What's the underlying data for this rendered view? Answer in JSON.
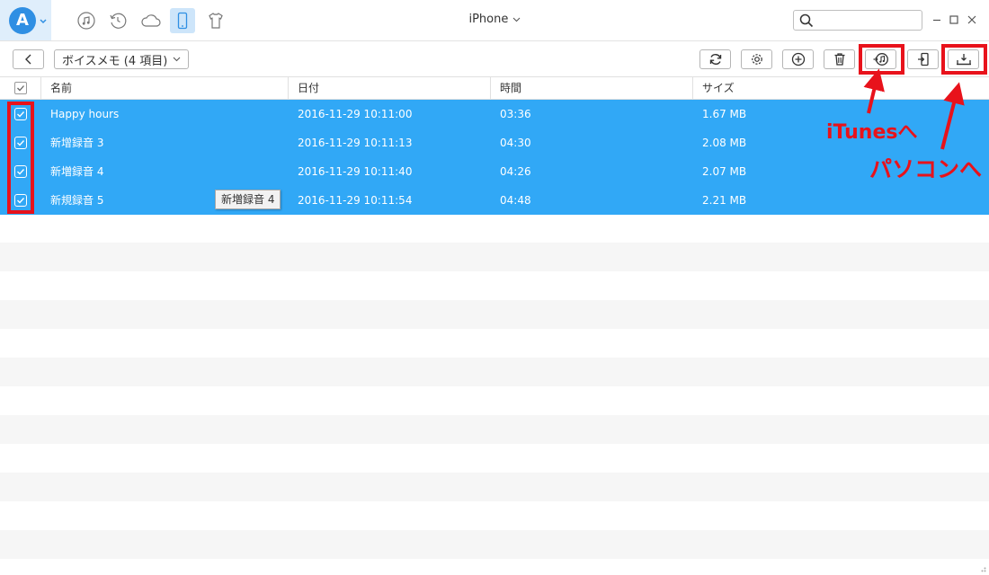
{
  "app": {
    "logo_letter": "A",
    "device_title": "iPhone"
  },
  "top_icons": [
    "music-icon",
    "history-icon",
    "cloud-icon",
    "phone-icon",
    "shirt-icon"
  ],
  "search": {
    "placeholder": "",
    "value": ""
  },
  "toolbar": {
    "category_label": "ボイスメモ (4 項目)",
    "buttons": [
      "refresh-icon",
      "settings-icon",
      "add-icon",
      "delete-icon",
      "to-itunes-icon",
      "to-device-icon",
      "to-computer-icon"
    ]
  },
  "table": {
    "headers": {
      "name": "名前",
      "date": "日付",
      "duration": "時間",
      "size": "サイズ"
    },
    "rows": [
      {
        "name": "Happy hours",
        "date": "2016-11-29 10:11:00",
        "duration": "03:36",
        "size": "1.67 MB"
      },
      {
        "name": "新增録音 3",
        "date": "2016-11-29 10:11:13",
        "duration": "04:30",
        "size": "2.08 MB"
      },
      {
        "name": "新増録音 4",
        "date": "2016-11-29 10:11:40",
        "duration": "04:26",
        "size": "2.07 MB"
      },
      {
        "name": "新規録音 5",
        "date": "2016-11-29 10:11:54",
        "duration": "04:48",
        "size": "2.21 MB"
      }
    ]
  },
  "tooltip": "新増録音 4",
  "annotations": {
    "itunes": "iTunesへ",
    "computer": "パソコンへ"
  },
  "colors": {
    "selection": "#31a8f6",
    "accent": "#2f8fe3",
    "annotation": "#e8121b"
  }
}
